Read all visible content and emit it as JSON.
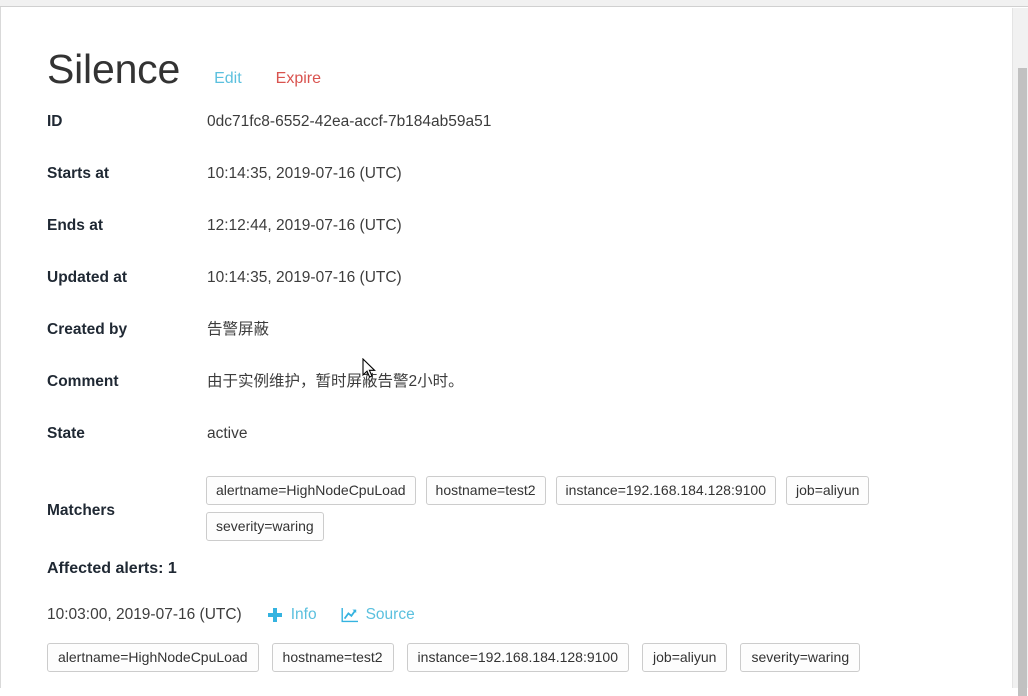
{
  "page": {
    "title": "Silence",
    "actions": [
      {
        "label": "Edit",
        "name": "edit-link",
        "color": "#5bc0de"
      },
      {
        "label": "Expire",
        "name": "expire-link",
        "color": "#d9534f"
      }
    ]
  },
  "details": {
    "id_label": "ID",
    "id_value": "0dc71fc8-6552-42ea-accf-7b184ab59a51",
    "starts_at_label": "Starts at",
    "starts_at_value": "10:14:35, 2019-07-16 (UTC)",
    "ends_at_label": "Ends at",
    "ends_at_value": "12:12:44, 2019-07-16 (UTC)",
    "updated_at_label": "Updated at",
    "updated_at_value": "10:14:35, 2019-07-16 (UTC)",
    "created_by_label": "Created by",
    "created_by_value": "告警屏蔽",
    "comment_label": "Comment",
    "comment_value": "由于实例维护，暂时屏蔽告警2小时。",
    "state_label": "State",
    "state_value": "active",
    "matchers_label": "Matchers",
    "matchers": [
      "alertname=HighNodeCpuLoad",
      "hostname=test2",
      "instance=192.168.184.128:9100",
      "job=aliyun",
      "severity=waring"
    ]
  },
  "affected": {
    "heading": "Affected alerts: 1",
    "alert": {
      "time": "10:03:00, 2019-07-16 (UTC)",
      "info_label": "Info",
      "info_icon": "plus-icon",
      "source_label": "Source",
      "source_icon": "chart-line-icon",
      "labels": [
        "alertname=HighNodeCpuLoad",
        "hostname=test2",
        "instance=192.168.184.128:9100",
        "job=aliyun",
        "severity=waring"
      ]
    }
  },
  "colors": {
    "link_info": "#5bc0de",
    "link_danger": "#d9534f",
    "chip_border": "#cccccc",
    "text": "#333333"
  }
}
